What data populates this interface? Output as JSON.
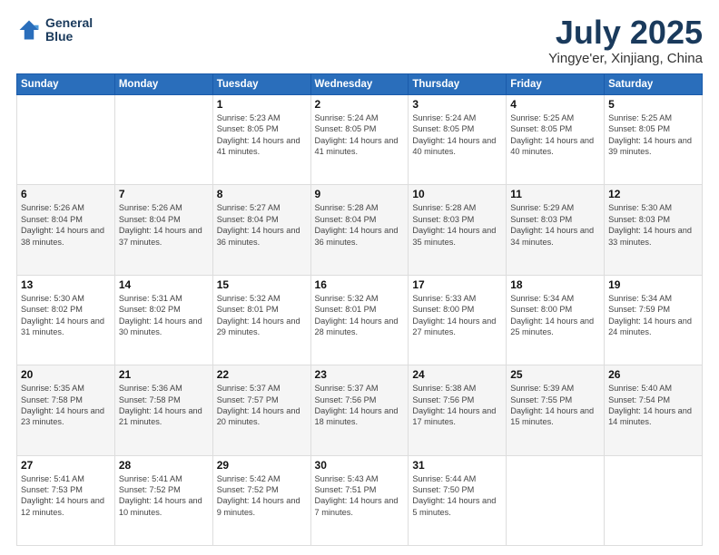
{
  "header": {
    "logo_line1": "General",
    "logo_line2": "Blue",
    "month": "July 2025",
    "location": "Yingye'er, Xinjiang, China"
  },
  "weekdays": [
    "Sunday",
    "Monday",
    "Tuesday",
    "Wednesday",
    "Thursday",
    "Friday",
    "Saturday"
  ],
  "weeks": [
    [
      {
        "day": "",
        "info": ""
      },
      {
        "day": "",
        "info": ""
      },
      {
        "day": "1",
        "info": "Sunrise: 5:23 AM\nSunset: 8:05 PM\nDaylight: 14 hours and 41 minutes."
      },
      {
        "day": "2",
        "info": "Sunrise: 5:24 AM\nSunset: 8:05 PM\nDaylight: 14 hours and 41 minutes."
      },
      {
        "day": "3",
        "info": "Sunrise: 5:24 AM\nSunset: 8:05 PM\nDaylight: 14 hours and 40 minutes."
      },
      {
        "day": "4",
        "info": "Sunrise: 5:25 AM\nSunset: 8:05 PM\nDaylight: 14 hours and 40 minutes."
      },
      {
        "day": "5",
        "info": "Sunrise: 5:25 AM\nSunset: 8:05 PM\nDaylight: 14 hours and 39 minutes."
      }
    ],
    [
      {
        "day": "6",
        "info": "Sunrise: 5:26 AM\nSunset: 8:04 PM\nDaylight: 14 hours and 38 minutes."
      },
      {
        "day": "7",
        "info": "Sunrise: 5:26 AM\nSunset: 8:04 PM\nDaylight: 14 hours and 37 minutes."
      },
      {
        "day": "8",
        "info": "Sunrise: 5:27 AM\nSunset: 8:04 PM\nDaylight: 14 hours and 36 minutes."
      },
      {
        "day": "9",
        "info": "Sunrise: 5:28 AM\nSunset: 8:04 PM\nDaylight: 14 hours and 36 minutes."
      },
      {
        "day": "10",
        "info": "Sunrise: 5:28 AM\nSunset: 8:03 PM\nDaylight: 14 hours and 35 minutes."
      },
      {
        "day": "11",
        "info": "Sunrise: 5:29 AM\nSunset: 8:03 PM\nDaylight: 14 hours and 34 minutes."
      },
      {
        "day": "12",
        "info": "Sunrise: 5:30 AM\nSunset: 8:03 PM\nDaylight: 14 hours and 33 minutes."
      }
    ],
    [
      {
        "day": "13",
        "info": "Sunrise: 5:30 AM\nSunset: 8:02 PM\nDaylight: 14 hours and 31 minutes."
      },
      {
        "day": "14",
        "info": "Sunrise: 5:31 AM\nSunset: 8:02 PM\nDaylight: 14 hours and 30 minutes."
      },
      {
        "day": "15",
        "info": "Sunrise: 5:32 AM\nSunset: 8:01 PM\nDaylight: 14 hours and 29 minutes."
      },
      {
        "day": "16",
        "info": "Sunrise: 5:32 AM\nSunset: 8:01 PM\nDaylight: 14 hours and 28 minutes."
      },
      {
        "day": "17",
        "info": "Sunrise: 5:33 AM\nSunset: 8:00 PM\nDaylight: 14 hours and 27 minutes."
      },
      {
        "day": "18",
        "info": "Sunrise: 5:34 AM\nSunset: 8:00 PM\nDaylight: 14 hours and 25 minutes."
      },
      {
        "day": "19",
        "info": "Sunrise: 5:34 AM\nSunset: 7:59 PM\nDaylight: 14 hours and 24 minutes."
      }
    ],
    [
      {
        "day": "20",
        "info": "Sunrise: 5:35 AM\nSunset: 7:58 PM\nDaylight: 14 hours and 23 minutes."
      },
      {
        "day": "21",
        "info": "Sunrise: 5:36 AM\nSunset: 7:58 PM\nDaylight: 14 hours and 21 minutes."
      },
      {
        "day": "22",
        "info": "Sunrise: 5:37 AM\nSunset: 7:57 PM\nDaylight: 14 hours and 20 minutes."
      },
      {
        "day": "23",
        "info": "Sunrise: 5:37 AM\nSunset: 7:56 PM\nDaylight: 14 hours and 18 minutes."
      },
      {
        "day": "24",
        "info": "Sunrise: 5:38 AM\nSunset: 7:56 PM\nDaylight: 14 hours and 17 minutes."
      },
      {
        "day": "25",
        "info": "Sunrise: 5:39 AM\nSunset: 7:55 PM\nDaylight: 14 hours and 15 minutes."
      },
      {
        "day": "26",
        "info": "Sunrise: 5:40 AM\nSunset: 7:54 PM\nDaylight: 14 hours and 14 minutes."
      }
    ],
    [
      {
        "day": "27",
        "info": "Sunrise: 5:41 AM\nSunset: 7:53 PM\nDaylight: 14 hours and 12 minutes."
      },
      {
        "day": "28",
        "info": "Sunrise: 5:41 AM\nSunset: 7:52 PM\nDaylight: 14 hours and 10 minutes."
      },
      {
        "day": "29",
        "info": "Sunrise: 5:42 AM\nSunset: 7:52 PM\nDaylight: 14 hours and 9 minutes."
      },
      {
        "day": "30",
        "info": "Sunrise: 5:43 AM\nSunset: 7:51 PM\nDaylight: 14 hours and 7 minutes."
      },
      {
        "day": "31",
        "info": "Sunrise: 5:44 AM\nSunset: 7:50 PM\nDaylight: 14 hours and 5 minutes."
      },
      {
        "day": "",
        "info": ""
      },
      {
        "day": "",
        "info": ""
      }
    ]
  ]
}
